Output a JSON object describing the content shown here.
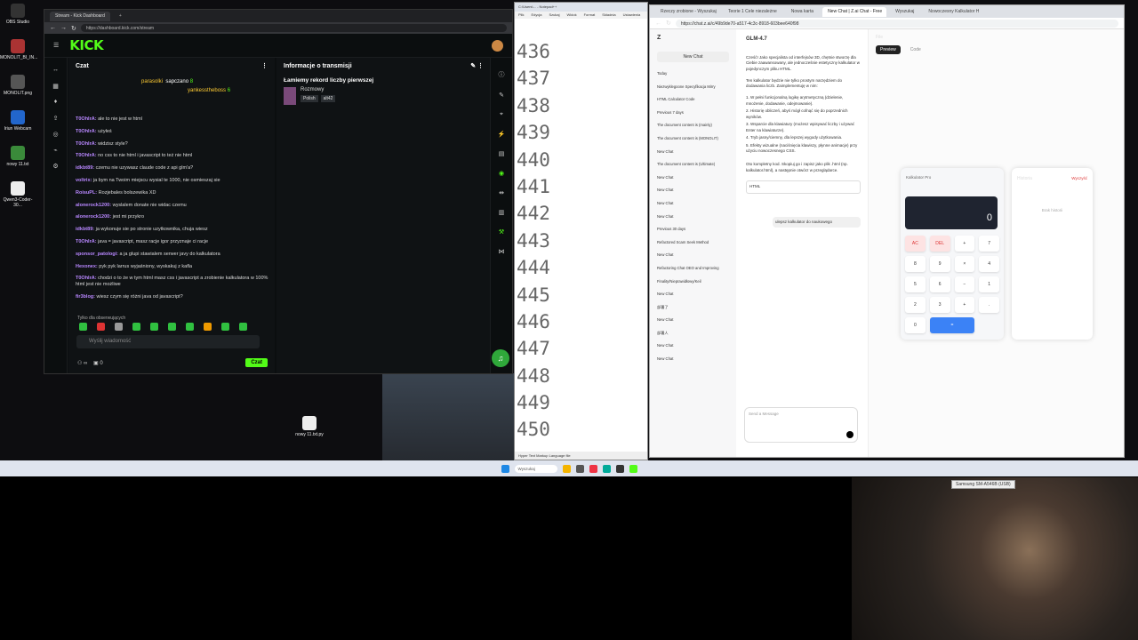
{
  "desktop_icons": [
    {
      "label": "OBS Studio",
      "color": "#333"
    },
    {
      "label": "MONOLIT_BI_IN...",
      "color": "#a33"
    },
    {
      "label": "MONOLIT.png",
      "color": "#555"
    },
    {
      "label": "Iriun Webcam",
      "color": "#2266cc"
    },
    {
      "label": "nowy 11.txt",
      "color": "#3a8a3a"
    },
    {
      "label": "Qwen3-Coder-30...",
      "color": "#eee"
    }
  ],
  "desktop_file": "nowy 11.txt.py",
  "kick": {
    "tab": "Stream - Kick Dashboard",
    "url": "https://dashboard.kick.com/stream",
    "logo": "KICK",
    "chat_title": "Czat",
    "leaders": [
      {
        "name": "parasolki",
        "n": ""
      },
      {
        "name": "sapczano",
        "n": "8"
      },
      {
        "name": "yankesstheboss",
        "n": "6"
      }
    ],
    "messages": [
      {
        "user": "T0OhIrA:",
        "text": "ale to nie jest w html"
      },
      {
        "user": "T0OhIrA:",
        "text": "użyłeś"
      },
      {
        "user": "T0OhIrA:",
        "text": "widzisz style?"
      },
      {
        "user": "T0OhIrA:",
        "text": "no css to nie html i javascript to też nie html"
      },
      {
        "user": "idkbt89:",
        "text": "czemu nie uzywasz claude code z api glm'a?"
      },
      {
        "user": "voltrix:",
        "text": "ja bym na Twoim miejscu wysial te 1000, nie osmieszaj sie"
      },
      {
        "user": "RoisuPL:",
        "text": "Rozjebales bolszewika XD"
      },
      {
        "user": "alonerock1200:",
        "text": "wyslalem donate nie widac czemu"
      },
      {
        "user": "alonerock1200:",
        "text": "jest mi przykro"
      },
      {
        "user": "idkbt89:",
        "text": "ja wykonuje sie po stronie uzytkownika, chuja wiesz"
      },
      {
        "user": "T0OhIrA:",
        "text": "java = javascript, masz racje igor przyznaje ci racje"
      },
      {
        "user": "sponsor_patologi:",
        "text": "a ja glupi stawialem serwer javy do kalkulatora"
      },
      {
        "user": "Hexonex:",
        "text": "pyk pyk larrus wyjaśniony, wyskakuj z kafla"
      },
      {
        "user": "T0OhIrA:",
        "text": "chodzi o to że w tym html masz css i javascript a zrobienie kalkulatora w 100% html jest nie możliwe"
      },
      {
        "user": "fir3blog:",
        "text": "wiesz czym się różni java od javascript?"
      }
    ],
    "followers_only": "Tylko dla obserwujących",
    "input_placeholder": "Wyślij wiadomość",
    "send_label": "Czat",
    "bottom_count": "0",
    "info_title": "Informacje o transmisji",
    "stream_title": "Łamiemy rekord liczby pierwszej",
    "category": "Rozmowy",
    "tags": [
      "Polish",
      "alt42"
    ]
  },
  "notepad": {
    "tabs": "C:\\Users\\... - Notepad++",
    "menu": [
      "Plik",
      "Edycja",
      "Szukaj",
      "Widok",
      "Format",
      "Składnia",
      "Ustawienia",
      "Narzędzia"
    ],
    "lines": [
      "436",
      "437",
      "438",
      "439",
      "440",
      "441",
      "442",
      "443",
      "444",
      "445",
      "446",
      "447",
      "448",
      "449",
      "450"
    ],
    "status": "Hyper Text Markup Language file"
  },
  "browser": {
    "tabs": [
      {
        "label": "Rzeczy zrobione - Wyszukaj"
      },
      {
        "label": "Teorie 1 Cele niezależne"
      },
      {
        "label": "Nowa karta"
      },
      {
        "label": "New Chat | Z.ai Chat - Free"
      },
      {
        "label": "Wyszukaj"
      },
      {
        "label": "Nowoczesny Kalkulator H"
      }
    ],
    "url": "https://chat.z.ai/c/49b9de70-a517-4c3c-8918-603bee640f98",
    "model": "GLM-4.7",
    "new_chat": "New Chat",
    "sidebar": [
      "Today",
      "Niezwyklegoone Specyfikacja Mirry",
      "HTML Calculator Code",
      "Previous 7 days",
      "The document content is (mainly)",
      "The document content is (MONOLIT)",
      "New Chat",
      "The document content is (Ultimate)",
      "New Chat",
      "New Chat",
      "New Chat",
      "New Chat",
      "Previous 30 days",
      "Refactored Scam Seek Method",
      "New Chat",
      "Refactoring Chat OEO and Improving",
      "Finality/Nieprawidłowy/Keil",
      "New Chat",
      "部署了",
      "New Chat",
      "部署人",
      "New Chat",
      "New Chat"
    ],
    "intro": "Cześć! Jako specjalista od interfejsów 3D, chętnie stworzę dla Ciebie zaawansowany, ale jednocześnie estetyczny kalkulator w pojedynczym pliku HTML.",
    "intro2": "Ten kalkulator będzie nie tylko prostym narzędziem do dodawania liczb. Zaimplementuję w nim:",
    "features": [
      "1. W pełni funkcjonalną logikę arytmetyczną (dzielenie, mnożenie, dodawanie, odejmowanie).",
      "2. Historię obliczeń, abyś mógł cofnąć się do poprzednich wyników.",
      "3. Wsparcie dla klawiatury (możesz wpisywać liczby i używać Enter na klawiaturze).",
      "4. Tryb jasny/ciemny, dla lepszej wygody użytkowania.",
      "5. Efekty wizualne (naciśnięcia klawiszy, płynne animacje) przy użyciu nowoczesnego CSS."
    ],
    "outro": "Oto kompletny kod. Skopiuj go i zapisz jako plik .html (np. kalkulator.html), a następnie otwórz w przeglądarce.",
    "code_label": "HTML",
    "user_msg": "ulepsz kalkulator do naukowego",
    "input_placeholder": "Send a Message",
    "panel_tab": "File",
    "preview_label": "Preview",
    "code_tab": "Code",
    "calc_title": "Kalkulator Pro",
    "display": "0",
    "keys": [
      "AC",
      "DEL",
      "+",
      "7",
      "8",
      "9",
      "×",
      "4",
      "5",
      "6",
      "−",
      "1",
      "2",
      "3",
      "+",
      ".",
      "0",
      "="
    ],
    "history_title": "Historia",
    "history_clear": "Wyczyść",
    "history_empty": "Brak historii"
  },
  "taskbar_search": "Wyszukaj",
  "cam_label": "Samsung SM-A546B (USB)"
}
